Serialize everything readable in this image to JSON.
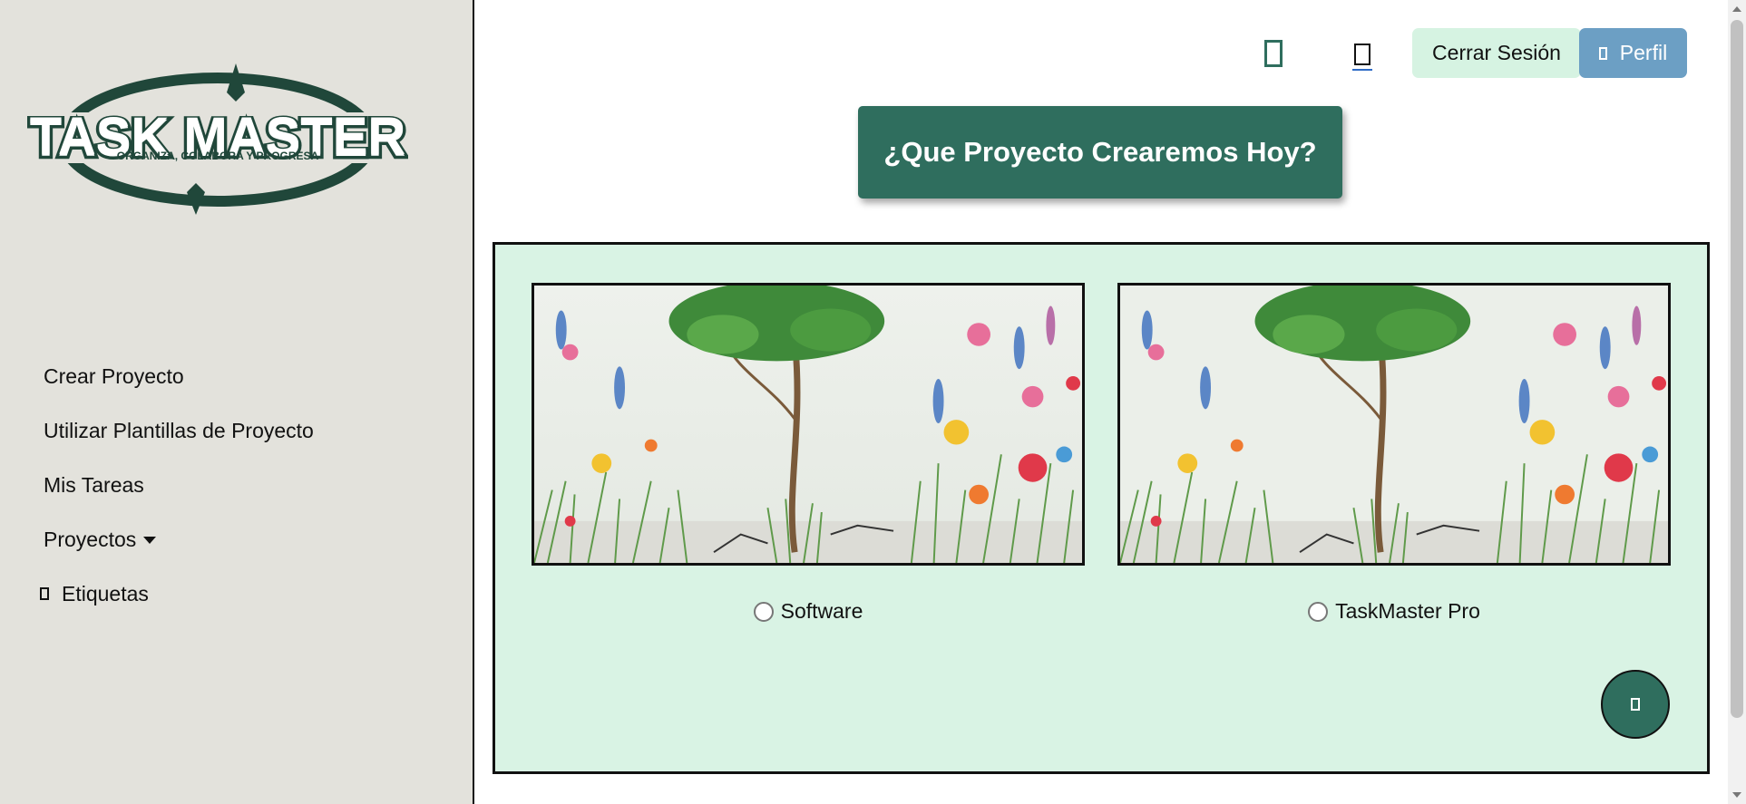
{
  "brand": {
    "logo_title": "TASK MASTER",
    "logo_tagline": "ORGANIZA, COLABORA Y PROGRESA"
  },
  "sidebar": {
    "items": [
      {
        "label": "Crear Proyecto"
      },
      {
        "label": "Utilizar Plantillas de Proyecto"
      },
      {
        "label": "Mis Tareas"
      },
      {
        "label": "Proyectos"
      },
      {
        "label": "Etiquetas"
      }
    ]
  },
  "topbar": {
    "logout_label": "Cerrar Sesión",
    "profile_label": "Perfil"
  },
  "main": {
    "hero_label": "¿Que Proyecto Crearemos Hoy?",
    "templates": [
      {
        "label": "Software"
      },
      {
        "label": "TaskMaster Pro"
      }
    ]
  },
  "colors": {
    "accent": "#2f6e5e",
    "panel_bg": "#d9f3e4",
    "sidebar_bg": "#e3e2dc",
    "profile_btn": "#6c9fc4",
    "logout_btn": "#d6f3e2"
  }
}
